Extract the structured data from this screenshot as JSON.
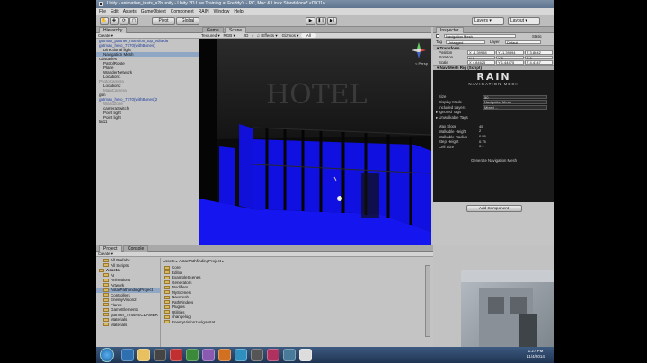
{
  "window": {
    "title": "Unity - animation_tests_a2b.unity - Unity 3D Live Training at Freddy's - PC, Mac & Linux Standalone* <DX11>"
  },
  "menu": [
    "File",
    "Edit",
    "Assets",
    "GameObject",
    "Component",
    "RAIN",
    "Window",
    "Help"
  ],
  "toolbar": {
    "pivot_label": "Pivot",
    "global_label": "Global",
    "layers_label": "Layers",
    "layout_label": "Layout"
  },
  "hierarchy": {
    "tab": "Hierarchy",
    "create_label": "Create",
    "rows": [
      {
        "label": "gutman_partner_mansion_top_edited6",
        "style": "blue",
        "indent": 0
      },
      {
        "label": "gutman_hero_7770(withBones)",
        "style": "blue",
        "indent": 0
      },
      {
        "label": "Directional light",
        "style": "",
        "indent": 1
      },
      {
        "label": "Navigation Mesh",
        "style": "sel",
        "indent": 1
      },
      {
        "label": "Obstacles",
        "style": "",
        "indent": 0
      },
      {
        "label": "PatrolRoute",
        "style": "",
        "indent": 1
      },
      {
        "label": "Plane",
        "style": "",
        "indent": 1
      },
      {
        "label": "WanderNetwork",
        "style": "",
        "indent": 1
      },
      {
        "label": "Location1",
        "style": "",
        "indent": 1
      },
      {
        "label": "PhotoCamera",
        "style": "grayed",
        "indent": 0
      },
      {
        "label": "Location2",
        "style": "",
        "indent": 1
      },
      {
        "label": "MainCamera",
        "style": "grayed",
        "indent": 1
      },
      {
        "label": "gun",
        "style": "",
        "indent": 0
      },
      {
        "label": "gutman_hero_7770(withBones)2",
        "style": "blue",
        "indent": 0
      },
      {
        "label": "WandZone",
        "style": "grayed",
        "indent": 1
      },
      {
        "label": "cameraSwitch",
        "style": "",
        "indent": 1
      },
      {
        "label": "Point light",
        "style": "",
        "indent": 1
      },
      {
        "label": "Point light",
        "style": "",
        "indent": 1
      },
      {
        "label": "tin11",
        "style": "",
        "indent": 0
      }
    ]
  },
  "scene": {
    "tab_game": "Game",
    "tab_scene": "Scene",
    "shading": "Textured",
    "rgb": "RGB",
    "mode_2d": "2D",
    "effects": "Effects",
    "gizmos": "Gizmos",
    "search_placeholder": "All",
    "persp_label": "< Persp",
    "sign_text": "HOTEL"
  },
  "inspector": {
    "tab": "Inspector",
    "object_name": "Navigation Mesh",
    "static_label": "Static",
    "tag_label": "Tag",
    "tag_value": "Untagged",
    "layer_label": "Layer",
    "layer_value": "Default",
    "transform": "Transform",
    "position_label": "Position",
    "position": {
      "x": "X -4.39958",
      "y": "Y -1.39594",
      "z": "Z 3.8642"
    },
    "rotation_label": "Rotation",
    "rotation": {
      "x": "X 0",
      "y": "Y 0",
      "z": "Z 0"
    },
    "scale_label": "Scale",
    "scale": {
      "x": "X 4.84625",
      "y": "Y 1.44475",
      "z": "Z 4.4147"
    },
    "component": "Nav Mesh Rig (Script)",
    "rain_logo": "RAIN",
    "rain_sub": "NAVIGATION MESH",
    "props": [
      {
        "label": "Size",
        "value": "50"
      },
      {
        "label": "Display Mode",
        "value": "Navigation Mesh"
      }
    ],
    "included_layers_label": "Included Layers",
    "included_layers_value": "Mixed ...",
    "ignored_tags": "Ignored Tags",
    "unwalkable_tags": "Unwalkable Tags",
    "nav_props": [
      {
        "label": "Max Slope",
        "value": "45"
      },
      {
        "label": "Walkable Height",
        "value": "2"
      },
      {
        "label": "Walkable Radius",
        "value": "0.55"
      },
      {
        "label": "Step Height",
        "value": "0.75"
      },
      {
        "label": "Cell Size",
        "value": "0.1"
      }
    ],
    "generate_label": "Generate Navigation Mesh",
    "add_component": "Add Component"
  },
  "project": {
    "tab_project": "Project",
    "tab_console": "Console",
    "create_label": "Create",
    "left_items": [
      {
        "label": "All Prefabs",
        "indent": 1
      },
      {
        "label": "All Scripts",
        "indent": 1
      },
      {
        "label": "Assets",
        "indent": 0,
        "bold": true
      },
      {
        "label": "AI",
        "indent": 1
      },
      {
        "label": "Animations",
        "indent": 1
      },
      {
        "label": "Artwork",
        "indent": 1
      },
      {
        "label": "AstarPathfindingProject",
        "indent": 1,
        "sel": true
      },
      {
        "label": "Controllers",
        "indent": 1
      },
      {
        "label": "EnemyVision2",
        "indent": 1
      },
      {
        "label": "Flares",
        "indent": 1
      },
      {
        "label": "GameElements",
        "indent": 1
      },
      {
        "label": "gutman_Tint4PECDAMER",
        "indent": 1
      },
      {
        "label": "Materials",
        "indent": 1
      },
      {
        "label": "Materials",
        "indent": 1
      }
    ],
    "breadcrumb": "Assets ▸ AstarPathfindingProject ▸",
    "right_items": [
      "Core",
      "Editor",
      "ExampleScenes",
      "Generators",
      "Modifiers",
      "MyScenes",
      "Navmesh",
      "PathFinders",
      "Plugins",
      "Utilities",
      "changelog",
      "EnemyVision1vulgarstat"
    ]
  },
  "taskbar": {
    "time": "1:27 PM",
    "date": "11/4/2014"
  },
  "colors": {
    "navmesh": "#1010e0",
    "selection": "#8fa6c4",
    "title": "#5f7590"
  }
}
